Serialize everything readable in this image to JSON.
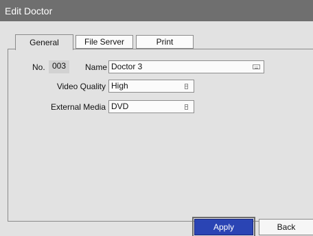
{
  "window": {
    "title": "Edit Doctor"
  },
  "tabs": [
    {
      "label": "General",
      "active": true
    },
    {
      "label": "File Server",
      "active": false
    },
    {
      "label": "Print",
      "active": false
    }
  ],
  "general": {
    "no_label": "No.",
    "no_value": "003",
    "name_label": "Name",
    "name_value": "Doctor 3",
    "name_icon": "keyboard-icon",
    "video_quality_label": "Video Quality",
    "video_quality_value": "High",
    "external_media_label": "External Media",
    "external_media_value": "DVD",
    "dropdown_icon": "list-icon"
  },
  "footer": {
    "apply_label": "Apply",
    "back_label": "Back"
  },
  "colors": {
    "titlebar": "#6f6f6f",
    "background": "#e2e2e2",
    "apply_accent": "#2a44b4"
  }
}
